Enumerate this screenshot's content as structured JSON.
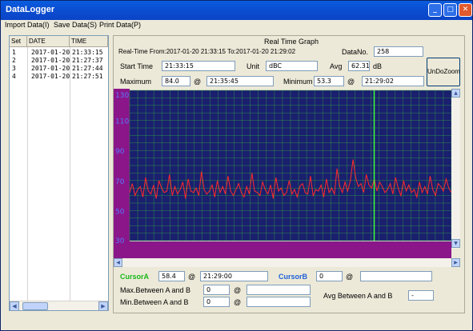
{
  "window": {
    "title": "DataLogger"
  },
  "menu": [
    "Import Data(I)",
    "Save Data(S)",
    "Print Data(P)"
  ],
  "list": {
    "columns": [
      "Set",
      "DATE",
      "TIME"
    ],
    "rows": [
      [
        "1",
        "2017-01-20",
        "21:33:15"
      ],
      [
        "2",
        "2017-01-20",
        "21:27:37"
      ],
      [
        "3",
        "2017-01-20",
        "21:27:44"
      ],
      [
        "4",
        "2017-01-20",
        "21:27:51"
      ]
    ]
  },
  "graph": {
    "title": "Real Time Graph",
    "range_text": "Real-Time From:2017-01-20 21:33:15 To:2017-01-20 21:29:02",
    "data_no_label": "DataNo.",
    "data_no": "258",
    "start_time_label": "Start Time",
    "start_time": "21:33:15",
    "unit_label": "Unit",
    "unit": "dBC",
    "avg_label": "Avg",
    "avg": "62.31",
    "avg_unit": "dB",
    "undozoom_label": "UnDoZoom",
    "maximum_label": "Maximum",
    "maximum": "84.0",
    "max_at": "21:35:45",
    "minimum_label": "Minimum",
    "minimum": "53.3",
    "min_at": "21:29:02",
    "at_symbol": "@",
    "cursorA_label": "CursorA",
    "cursorA_value": "58.4",
    "cursorA_time": "21:29:00",
    "cursorB_label": "CursorB",
    "cursorB_value": "0",
    "cursorB_time": "",
    "max_between_label": "Max.Between A and B",
    "max_between_value": "0",
    "max_between_time": "",
    "min_between_label": "Min.Between A and B",
    "min_between_value": "0",
    "min_between_time": "",
    "avg_between_label": "Avg Between A and B",
    "avg_between_value": "-"
  },
  "colors": {
    "plot_bg": "#1a1f6e",
    "grid": "#2e8f4a",
    "trace": "#ff2a2a",
    "cursor": "#3cff3c",
    "axis_band": "#8a168a"
  },
  "chart_data": {
    "type": "line",
    "ylim": [
      30,
      130
    ],
    "yticks": [
      "130",
      "110",
      "90",
      "70",
      "50",
      "30"
    ],
    "cursor_x_fraction": 0.76,
    "series": [
      {
        "values": [
          62,
          68,
          60,
          64,
          66,
          59,
          72,
          63,
          61,
          67,
          58,
          70,
          65,
          62,
          63,
          74,
          60,
          66,
          61,
          64,
          69,
          58,
          71,
          63,
          62,
          65,
          60,
          76,
          64,
          61,
          63,
          67,
          59,
          70,
          62,
          66,
          61,
          73,
          63,
          60,
          64,
          68,
          62,
          59,
          66,
          61,
          75,
          63,
          62,
          60,
          69,
          64,
          61,
          67,
          58,
          72,
          63,
          65,
          60,
          62,
          70,
          61,
          64,
          59,
          66,
          68,
          62,
          61,
          73,
          60,
          64,
          63,
          67,
          59,
          71,
          62,
          65,
          61,
          78,
          66,
          62,
          69,
          63,
          70,
          84,
          72,
          66,
          68,
          62,
          74,
          67,
          65,
          71,
          63,
          69,
          66,
          62,
          64,
          68,
          61,
          72,
          65,
          60,
          70,
          63,
          67,
          62,
          64,
          59,
          69,
          62,
          66,
          61,
          73,
          64,
          60,
          68,
          66,
          63,
          71,
          65,
          62
        ]
      }
    ]
  }
}
